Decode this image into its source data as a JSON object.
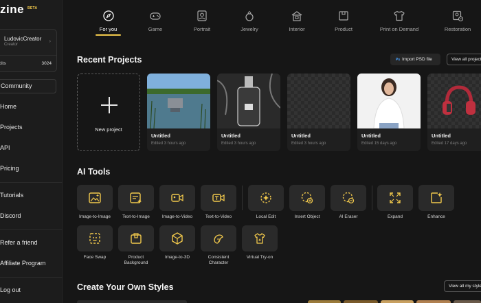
{
  "brand": {
    "logo": "zine",
    "badge": "BETA"
  },
  "user": {
    "name": "LudovicCreator",
    "role": "Creator",
    "credits_label": "edits",
    "credits_value": "3024"
  },
  "sidebar": {
    "community": "Community",
    "items": [
      "Home",
      "Projects",
      "API",
      "Pricing",
      "Tutorials",
      "Discord",
      "Refer a friend",
      "Affiliate Program",
      "Log out"
    ]
  },
  "categories": [
    {
      "label": "For you",
      "icon": "compass-icon",
      "active": true
    },
    {
      "label": "Game",
      "icon": "gamepad-icon"
    },
    {
      "label": "Portrait",
      "icon": "portrait-icon"
    },
    {
      "label": "Jewelry",
      "icon": "ring-icon"
    },
    {
      "label": "Interior",
      "icon": "house-icon"
    },
    {
      "label": "Product",
      "icon": "box-icon"
    },
    {
      "label": "Print on Demand",
      "icon": "tshirt-icon"
    },
    {
      "label": "Restoration",
      "icon": "photo-restore-icon"
    }
  ],
  "recent": {
    "title": "Recent Projects",
    "import_label": "Import PSD file",
    "import_badge": "Ps",
    "view_all": "View all projects",
    "new_project": "New project",
    "projects": [
      {
        "title": "Untitled",
        "time": "Edited 3 hours ago",
        "thumb": "lake-photo"
      },
      {
        "title": "Untitled",
        "time": "Edited 3 hours ago",
        "thumb": "perfume-bottle"
      },
      {
        "title": "Untitled",
        "time": "Edited 3 hours ago",
        "thumb": "transparent"
      },
      {
        "title": "Untitled",
        "time": "Edited 15 days ago",
        "thumb": "woman-portrait"
      },
      {
        "title": "Untitled",
        "time": "Edited 17 days ago",
        "thumb": "headphones"
      }
    ]
  },
  "ai_tools": {
    "title": "AI Tools",
    "row1": [
      "Image-to-Image",
      "Text-to-Image",
      "Image-to-Video",
      "Text-to-Video",
      "Local Edit",
      "Insert Object",
      "AI Eraser",
      "Expand",
      "Enhance"
    ],
    "row2": [
      "Face Swap",
      "Product\nBackground",
      "Image-to-3D",
      "Consistent\nCharacter",
      "Virtual Try-on"
    ]
  },
  "styles": {
    "title": "Create Your Own Styles",
    "view_all": "View all my styles"
  },
  "colors": {
    "accent": "#f2c94c",
    "bg": "#161616",
    "sidebar": "#1c1c1c",
    "card": "#2a2a2a"
  }
}
